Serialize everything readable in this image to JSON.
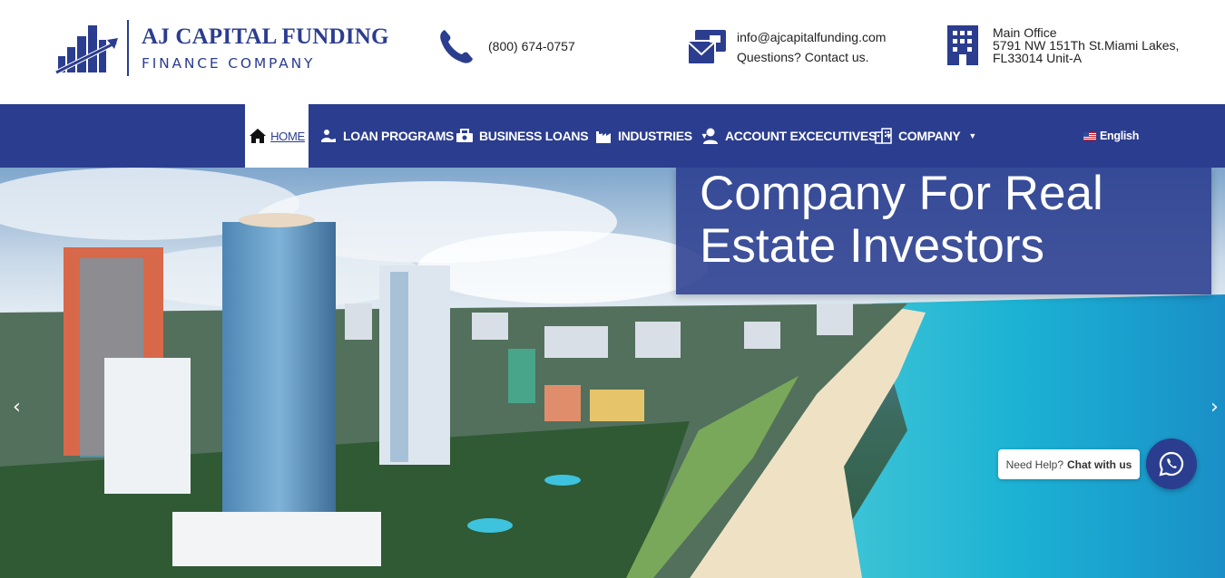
{
  "brand": {
    "name": "AJ CAPITAL FUNDING",
    "tagline": "FINANCE COMPANY",
    "color": "#2b3d8f"
  },
  "contact": {
    "phone": "(800) 674-0757",
    "email": "info@ajcapitalfunding.com",
    "email_prompt": "Questions? Contact us.",
    "office_label": "Main Office",
    "office_line1": "5791 NW 151Th St.Miami Lakes,",
    "office_line2": "FL33014 Unit-A"
  },
  "nav": {
    "home": "HOME",
    "loan_programs": "LOAN PROGRAMS",
    "business_loans": "BUSINESS LOANS",
    "industries": "INDUSTRIES",
    "account_executives": "ACCOUNT EXCECUTIVES",
    "company": "COMPANY",
    "language": "English",
    "icons": [
      "home-icon",
      "loan-icon",
      "business-icon",
      "industry-icon",
      "user-icon",
      "building-icon"
    ]
  },
  "hero": {
    "caption_line1": "Company For Real",
    "caption_line2": "Estate Investors",
    "prev_arrow": "‹",
    "next_arrow": "›"
  },
  "chat": {
    "prompt": "Need Help?",
    "action": "Chat with us",
    "icon": "whatsapp-icon"
  }
}
